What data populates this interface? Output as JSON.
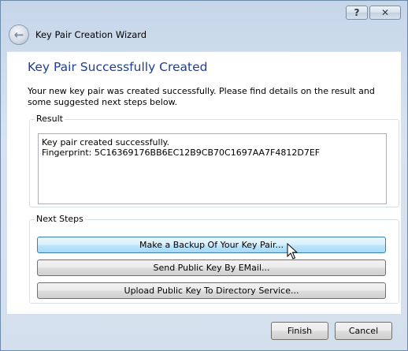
{
  "window": {
    "help_glyph": "?",
    "close_glyph": "✕",
    "back_glyph": "←",
    "title": "Key Pair Creation Wizard"
  },
  "page": {
    "title": "Key Pair Successfully Created",
    "intro": "Your new key pair was created successfully. Please find details on the result and some suggested next steps below."
  },
  "result": {
    "label": "Result",
    "line1": "Key pair created successfully.",
    "line2": "Fingerprint: 5C16369176BB6EC12B9CB70C1697AA7F4812D7EF"
  },
  "next_steps": {
    "label": "Next Steps",
    "backup": "Make a Backup Of Your Key Pair...",
    "email": "Send Public Key By EMail...",
    "upload": "Upload Public Key To Directory Service..."
  },
  "footer": {
    "finish": "Finish",
    "cancel": "Cancel"
  },
  "colors": {
    "title_blue": "#1e3f8f",
    "hover_blue": "#bee6fd"
  }
}
